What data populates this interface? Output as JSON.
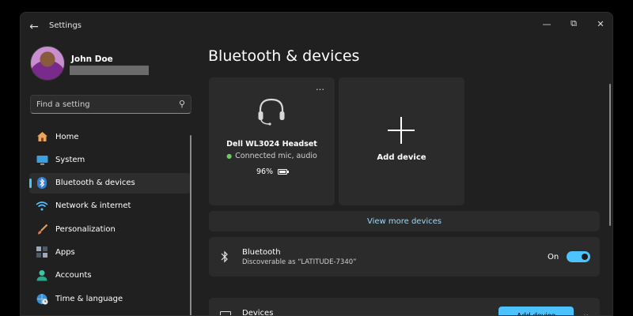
{
  "window": {
    "title": "Settings",
    "controls": {
      "minimize": "—",
      "maximize": "⧉",
      "close": "✕"
    }
  },
  "profile": {
    "name": "John Doe"
  },
  "search": {
    "placeholder": "Find a setting",
    "value": ""
  },
  "nav": {
    "items": [
      {
        "label": "Home",
        "icon": "home-icon",
        "active": false
      },
      {
        "label": "System",
        "icon": "monitor-icon",
        "active": false
      },
      {
        "label": "Bluetooth & devices",
        "icon": "bluetooth-icon",
        "active": true
      },
      {
        "label": "Network & internet",
        "icon": "wifi-icon",
        "active": false
      },
      {
        "label": "Personalization",
        "icon": "brush-icon",
        "active": false
      },
      {
        "label": "Apps",
        "icon": "apps-icon",
        "active": false
      },
      {
        "label": "Accounts",
        "icon": "person-icon",
        "active": false
      },
      {
        "label": "Time & language",
        "icon": "globe-clock-icon",
        "active": false
      }
    ]
  },
  "main": {
    "title": "Bluetooth & devices",
    "device_card": {
      "name": "Dell WL3024 Headset",
      "status": "Connected mic, audio",
      "battery": "96%",
      "more": "…"
    },
    "add_device_card": {
      "label": "Add device"
    },
    "view_more": "View more devices",
    "bluetooth": {
      "title": "Bluetooth",
      "subtitle": "Discoverable as “LATITUDE-7340”",
      "toggle_label": "On",
      "enabled": true
    },
    "devices_row": {
      "title": "Devices",
      "button": "Add device"
    }
  },
  "colors": {
    "accent": "#4cc2ff",
    "window_bg": "#202020",
    "card_bg": "#2b2b2b",
    "link": "#9fd8f5",
    "connected": "#6ccb5f"
  }
}
